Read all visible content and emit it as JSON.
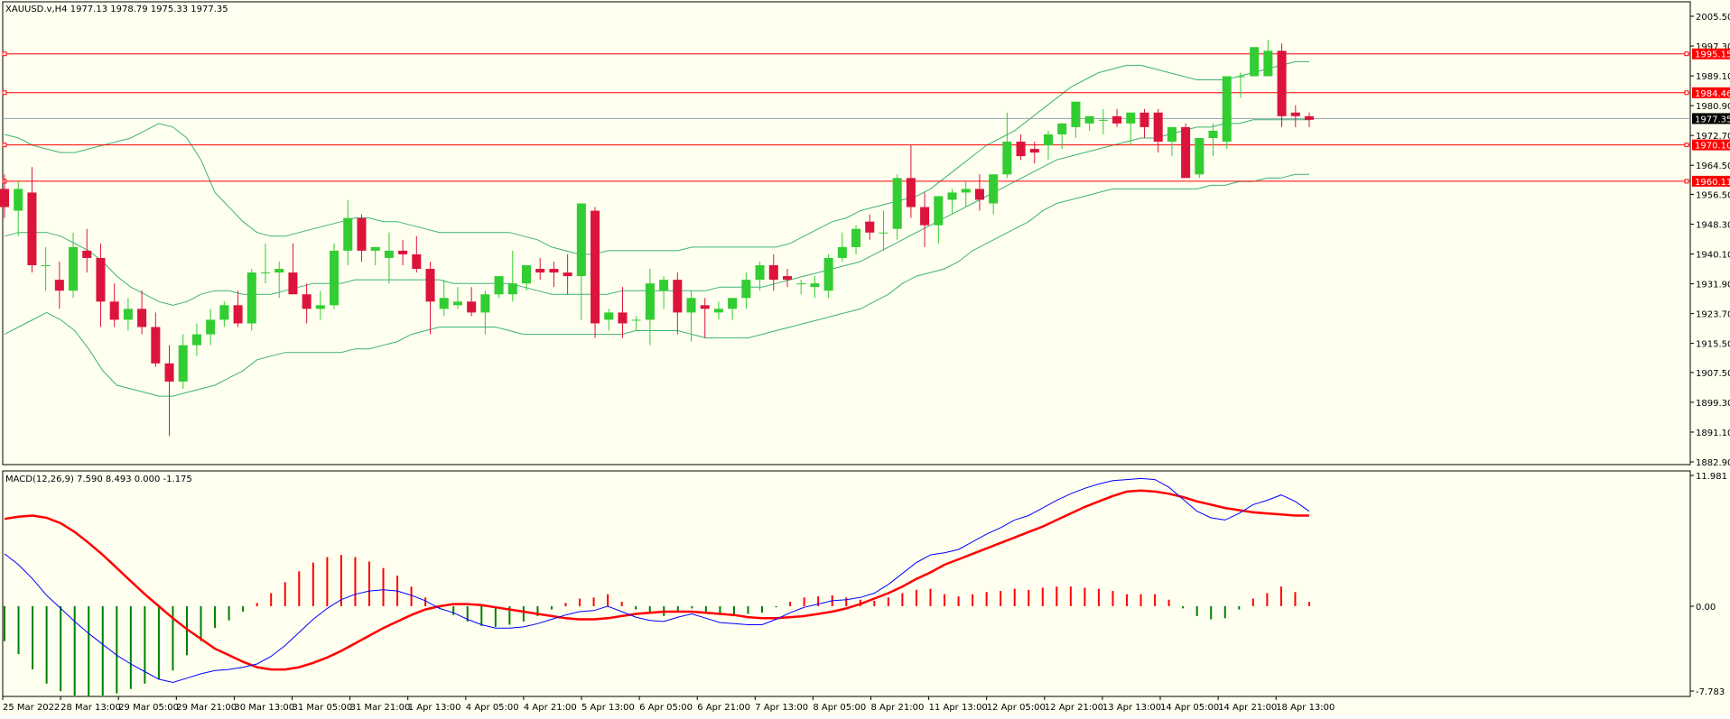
{
  "main_header": "XAUUSD.v,H4  1977.13 1978.79 1975.33 1977.35",
  "macd_header": "MACD(12,26,9) 7.590 8.493 0.000 -1.175",
  "colors": {
    "background": "#fffff0",
    "bull": "#32cd32",
    "bear": "#dc143c",
    "bands": "#3cb371",
    "level": "#ff0000",
    "current_price": "#8fa0b8",
    "macd_line": "#0000ff",
    "signal_line": "#ff0000",
    "hist_pos": "#ff0000",
    "hist_neg": "#008000"
  },
  "chart_data": [
    {
      "type": "candlestick",
      "symbol": "XAUUSD.v",
      "timeframe": "H4",
      "ylim": [
        1882.9,
        2008.2
      ],
      "y_ticks": [
        "2005.50",
        "1997.30",
        "1989.10",
        "1980.90",
        "1972.70",
        "1964.50",
        "1956.50",
        "1948.30",
        "1940.10",
        "1931.90",
        "1923.70",
        "1915.50",
        "1907.50",
        "1899.30",
        "1891.10",
        "1882.90"
      ],
      "x_labels": [
        "25 Mar 2022",
        "28 Mar 13:00",
        "29 Mar 05:00",
        "29 Mar 21:00",
        "30 Mar 13:00",
        "31 Mar 05:00",
        "31 Mar 21:00",
        "1 Apr 13:00",
        "4 Apr 05:00",
        "4 Apr 21:00",
        "5 Apr 13:00",
        "6 Apr 05:00",
        "6 Apr 21:00",
        "7 Apr 13:00",
        "8 Apr 05:00",
        "8 Apr 21:00",
        "11 Apr 13:00",
        "12 Apr 05:00",
        "12 Apr 21:00",
        "13 Apr 13:00",
        "14 Apr 05:00",
        "14 Apr 21:00",
        "18 Apr 13:00"
      ],
      "price_levels": [
        {
          "value": 1995.15,
          "label": "1995.15"
        },
        {
          "value": 1984.46,
          "label": "1984.46"
        },
        {
          "value": 1970.1,
          "label": "1970.10"
        },
        {
          "value": 1960.11,
          "label": "1960.11"
        }
      ],
      "current_price": {
        "value": 1977.35,
        "label": "1977.35"
      },
      "candles": [
        [
          1958,
          1962,
          1950,
          1953
        ],
        [
          1952,
          1960,
          1945,
          1958
        ],
        [
          1957,
          1964,
          1935,
          1937
        ],
        [
          1937,
          1942,
          1930,
          1937
        ],
        [
          1933,
          1938,
          1925,
          1930
        ],
        [
          1930,
          1946,
          1928,
          1942
        ],
        [
          1941,
          1947,
          1935,
          1939
        ],
        [
          1939,
          1943,
          1920,
          1927
        ],
        [
          1927,
          1932,
          1920,
          1922
        ],
        [
          1922,
          1928,
          1919,
          1925
        ],
        [
          1925,
          1930,
          1918,
          1920
        ],
        [
          1920,
          1924,
          1909,
          1910
        ],
        [
          1910,
          1915,
          1890,
          1905
        ],
        [
          1905,
          1918,
          1903,
          1915
        ],
        [
          1915,
          1921,
          1912,
          1918
        ],
        [
          1918,
          1925,
          1915,
          1922
        ],
        [
          1922,
          1927,
          1920,
          1926
        ],
        [
          1926,
          1930,
          1920,
          1921
        ],
        [
          1921,
          1936,
          1919,
          1935
        ],
        [
          1935,
          1943,
          1932,
          1935
        ],
        [
          1935,
          1938,
          1928,
          1936
        ],
        [
          1935,
          1943,
          1933,
          1929
        ],
        [
          1929,
          1932,
          1921,
          1925
        ],
        [
          1925,
          1930,
          1922,
          1926
        ],
        [
          1926,
          1943,
          1925,
          1941
        ],
        [
          1941,
          1955,
          1937,
          1950
        ],
        [
          1950,
          1951,
          1938,
          1941
        ],
        [
          1941,
          1942,
          1937,
          1942
        ],
        [
          1939,
          1946,
          1932,
          1941
        ],
        [
          1941,
          1944,
          1937,
          1940
        ],
        [
          1940,
          1945,
          1935,
          1936
        ],
        [
          1936,
          1938,
          1918,
          1927
        ],
        [
          1925,
          1933,
          1923,
          1928
        ],
        [
          1926,
          1931,
          1925,
          1927
        ],
        [
          1927,
          1931,
          1923,
          1924
        ],
        [
          1924,
          1930,
          1918,
          1929
        ],
        [
          1929,
          1934,
          1928,
          1934
        ],
        [
          1929,
          1941,
          1927,
          1932
        ],
        [
          1932,
          1936,
          1930,
          1937
        ],
        [
          1936,
          1939,
          1933,
          1935
        ],
        [
          1936,
          1938,
          1931,
          1935
        ],
        [
          1935,
          1940,
          1929,
          1934
        ],
        [
          1934,
          1948,
          1922,
          1954
        ],
        [
          1952,
          1953,
          1917,
          1921
        ],
        [
          1922,
          1925,
          1919,
          1924
        ],
        [
          1924,
          1931,
          1917,
          1921
        ],
        [
          1922,
          1923,
          1919,
          1922
        ],
        [
          1922,
          1936,
          1915,
          1932
        ],
        [
          1930,
          1934,
          1925,
          1933
        ],
        [
          1933,
          1935,
          1918,
          1924
        ],
        [
          1924,
          1930,
          1916,
          1928
        ],
        [
          1926,
          1928,
          1917,
          1925
        ],
        [
          1924,
          1927,
          1922,
          1925
        ],
        [
          1925,
          1927,
          1922,
          1928
        ],
        [
          1928,
          1935,
          1925,
          1933
        ],
        [
          1933,
          1938,
          1930,
          1937
        ],
        [
          1937,
          1940,
          1930,
          1933
        ],
        [
          1934,
          1936,
          1931,
          1933
        ],
        [
          1932,
          1933,
          1929,
          1932
        ],
        [
          1931,
          1934,
          1928,
          1932
        ],
        [
          1930,
          1940,
          1928,
          1939
        ],
        [
          1939,
          1946,
          1938,
          1942
        ],
        [
          1942,
          1948,
          1940,
          1947
        ],
        [
          1949,
          1951,
          1944,
          1946
        ],
        [
          1946,
          1952,
          1941,
          1946
        ],
        [
          1947,
          1962,
          1944,
          1961
        ],
        [
          1961,
          1970,
          1950,
          1953
        ],
        [
          1953,
          1957,
          1942,
          1948
        ],
        [
          1948,
          1956,
          1943,
          1956
        ],
        [
          1955,
          1958,
          1951,
          1957
        ],
        [
          1957,
          1960,
          1953,
          1958
        ],
        [
          1958,
          1962,
          1952,
          1955
        ],
        [
          1954,
          1962,
          1951,
          1962
        ],
        [
          1962,
          1979,
          1961,
          1971
        ],
        [
          1971,
          1973,
          1966,
          1967
        ],
        [
          1969,
          1971,
          1965,
          1968
        ],
        [
          1970,
          1974,
          1966,
          1973
        ],
        [
          1973,
          1976,
          1969,
          1976
        ],
        [
          1975,
          1979,
          1972,
          1982
        ],
        [
          1976,
          1978,
          1974,
          1978
        ],
        [
          1977,
          1980,
          1973,
          1977
        ],
        [
          1978,
          1980,
          1975,
          1976
        ],
        [
          1976,
          1979,
          1970,
          1979
        ],
        [
          1979,
          1980,
          1972,
          1975
        ],
        [
          1979,
          1980,
          1968,
          1971
        ],
        [
          1971,
          1974,
          1967,
          1975
        ],
        [
          1975,
          1976,
          1964,
          1961
        ],
        [
          1962,
          1972,
          1961,
          1972
        ],
        [
          1972,
          1976,
          1967,
          1974
        ],
        [
          1971,
          1984,
          1969,
          1989
        ],
        [
          1989,
          1990,
          1983,
          1989
        ],
        [
          1989,
          1996,
          1989,
          1997
        ],
        [
          1989,
          1999,
          1991,
          1996
        ],
        [
          1996,
          1998,
          1975,
          1978
        ],
        [
          1979,
          1981,
          1975,
          1978
        ],
        [
          1978,
          1979,
          1975,
          1977
        ]
      ],
      "bands": {
        "upper": [
          1973,
          1972,
          1970,
          1969,
          1968,
          1968,
          1969,
          1970,
          1971,
          1972,
          1974,
          1976,
          1975,
          1972,
          1966,
          1957,
          1953,
          1949,
          1946,
          1945,
          1945,
          1946,
          1947,
          1948,
          1949,
          1950,
          1950,
          1949,
          1949,
          1948,
          1947,
          1946,
          1946,
          1946,
          1946,
          1946,
          1946,
          1945,
          1944,
          1942,
          1941,
          1940,
          1940,
          1941,
          1941,
          1941,
          1941,
          1941,
          1941,
          1942,
          1942,
          1942,
          1942,
          1942,
          1942,
          1942,
          1943,
          1945,
          1947,
          1949,
          1950,
          1952,
          1953,
          1954,
          1955,
          1956,
          1958,
          1961,
          1964,
          1967,
          1970,
          1972,
          1974,
          1977,
          1980,
          1983,
          1986,
          1988,
          1990,
          1991,
          1992,
          1992,
          1991,
          1990,
          1989,
          1988,
          1988,
          1988,
          1989,
          1990,
          1991,
          1992,
          1993,
          1993
        ],
        "middle": [
          1945,
          1946,
          1946,
          1946,
          1945,
          1943,
          1941,
          1938,
          1934,
          1931,
          1929,
          1927,
          1926,
          1927,
          1929,
          1930,
          1930,
          1929,
          1929,
          1929,
          1930,
          1931,
          1932,
          1932,
          1932,
          1933,
          1933,
          1933,
          1933,
          1933,
          1933,
          1933,
          1932,
          1932,
          1932,
          1932,
          1932,
          1931,
          1930,
          1929,
          1929,
          1929,
          1929,
          1929,
          1930,
          1930,
          1930,
          1930,
          1930,
          1930,
          1930,
          1931,
          1931,
          1931,
          1931,
          1932,
          1933,
          1934,
          1935,
          1936,
          1937,
          1938,
          1940,
          1942,
          1944,
          1946,
          1948,
          1950,
          1952,
          1954,
          1956,
          1958,
          1960,
          1962,
          1964,
          1966,
          1967,
          1968,
          1969,
          1970,
          1971,
          1972,
          1972,
          1973,
          1974,
          1975,
          1975,
          1976,
          1976,
          1977,
          1977,
          1977,
          1977,
          1977
        ],
        "lower": [
          1918,
          1920,
          1922,
          1924,
          1922,
          1919,
          1914,
          1908,
          1904,
          1903,
          1902,
          1901,
          1901,
          1902,
          1903,
          1904,
          1906,
          1908,
          1911,
          1912,
          1913,
          1913,
          1913,
          1913,
          1913,
          1914,
          1914,
          1915,
          1916,
          1918,
          1919,
          1920,
          1920,
          1920,
          1920,
          1920,
          1919,
          1918,
          1918,
          1918,
          1918,
          1918,
          1918,
          1918,
          1918,
          1919,
          1919,
          1919,
          1919,
          1918,
          1917,
          1917,
          1917,
          1917,
          1918,
          1919,
          1920,
          1921,
          1922,
          1923,
          1924,
          1925,
          1927,
          1929,
          1932,
          1934,
          1935,
          1936,
          1938,
          1941,
          1943,
          1945,
          1947,
          1949,
          1952,
          1954,
          1955,
          1956,
          1957,
          1958,
          1958,
          1958,
          1958,
          1958,
          1958,
          1958,
          1959,
          1959,
          1960,
          1960,
          1961,
          1961,
          1962,
          1962
        ]
      }
    },
    {
      "type": "macd",
      "params": "MACD(12,26,9)",
      "ylim": [
        -7.783,
        11.981
      ],
      "y_ticks": [
        "11.981",
        "0.00",
        "-7.783"
      ],
      "macd": [
        4.8,
        3.8,
        2.5,
        1.0,
        -0.2,
        -1.4,
        -2.5,
        -3.5,
        -4.5,
        -5.3,
        -6.0,
        -6.7,
        -7.0,
        -6.6,
        -6.2,
        -5.9,
        -5.8,
        -5.6,
        -5.3,
        -4.6,
        -3.6,
        -2.4,
        -1.2,
        -0.2,
        0.6,
        1.1,
        1.4,
        1.5,
        1.4,
        1.0,
        0.5,
        -0.2,
        -0.6,
        -1.2,
        -1.7,
        -2.0,
        -2.0,
        -1.9,
        -1.6,
        -1.2,
        -0.8,
        -0.5,
        -0.4,
        0.0,
        -0.5,
        -1.0,
        -1.3,
        -1.4,
        -1.0,
        -0.7,
        -1.1,
        -1.5,
        -1.6,
        -1.7,
        -1.7,
        -1.2,
        -0.6,
        -0.1,
        0.2,
        0.5,
        0.6,
        0.8,
        1.2,
        2.0,
        3.0,
        4.0,
        4.7,
        4.9,
        5.2,
        5.9,
        6.6,
        7.2,
        7.9,
        8.3,
        9.0,
        9.7,
        10.3,
        10.8,
        11.2,
        11.5,
        11.6,
        11.7,
        11.6,
        10.9,
        9.8,
        8.7,
        8.1,
        7.9,
        8.5,
        9.3,
        9.7,
        10.2,
        9.6,
        8.7
      ],
      "signal": [
        8.0,
        8.2,
        8.3,
        8.1,
        7.6,
        6.8,
        5.8,
        4.7,
        3.5,
        2.3,
        1.1,
        0.0,
        -1.1,
        -2.1,
        -3.0,
        -3.9,
        -4.5,
        -5.1,
        -5.6,
        -5.8,
        -5.8,
        -5.6,
        -5.2,
        -4.7,
        -4.1,
        -3.4,
        -2.7,
        -2.0,
        -1.4,
        -0.8,
        -0.3,
        0.0,
        0.2,
        0.2,
        0.1,
        -0.1,
        -0.3,
        -0.5,
        -0.7,
        -0.9,
        -1.1,
        -1.2,
        -1.2,
        -1.1,
        -0.9,
        -0.7,
        -0.6,
        -0.5,
        -0.5,
        -0.5,
        -0.6,
        -0.7,
        -0.8,
        -1.0,
        -1.1,
        -1.1,
        -1.0,
        -0.9,
        -0.7,
        -0.5,
        -0.2,
        0.2,
        0.7,
        1.2,
        1.8,
        2.5,
        3.1,
        3.8,
        4.3,
        4.8,
        5.3,
        5.8,
        6.3,
        6.8,
        7.3,
        7.9,
        8.5,
        9.1,
        9.6,
        10.1,
        10.5,
        10.6,
        10.5,
        10.3,
        10.0,
        9.6,
        9.3,
        9.0,
        8.8,
        8.6,
        8.5,
        8.4,
        8.3,
        8.3
      ],
      "histogram": [
        -3.2,
        -4.4,
        -5.8,
        -7.1,
        -7.8,
        -8.2,
        -8.3,
        -8.2,
        -8.0,
        -7.6,
        -7.1,
        -6.7,
        -5.9,
        -4.5,
        -3.2,
        -2.0,
        -1.3,
        -0.5,
        0.3,
        1.2,
        2.2,
        3.2,
        4.0,
        4.5,
        4.7,
        4.5,
        4.1,
        3.5,
        2.8,
        1.8,
        0.8,
        -0.2,
        -0.8,
        -1.4,
        -1.8,
        -1.9,
        -1.7,
        -1.4,
        -0.9,
        -0.3,
        0.3,
        0.7,
        0.8,
        1.1,
        0.4,
        -0.3,
        -0.7,
        -0.9,
        -0.5,
        -0.2,
        -0.5,
        -0.8,
        -0.8,
        -0.7,
        -0.6,
        -0.1,
        0.4,
        0.8,
        0.9,
        1.0,
        0.8,
        0.6,
        0.5,
        0.8,
        1.2,
        1.5,
        1.6,
        1.1,
        0.9,
        1.1,
        1.3,
        1.4,
        1.6,
        1.5,
        1.7,
        1.8,
        1.8,
        1.7,
        1.6,
        1.4,
        1.1,
        1.1,
        1.1,
        0.6,
        -0.2,
        -0.9,
        -1.2,
        -1.1,
        -0.3,
        0.7,
        1.2,
        1.8,
        1.3,
        0.4
      ]
    }
  ]
}
